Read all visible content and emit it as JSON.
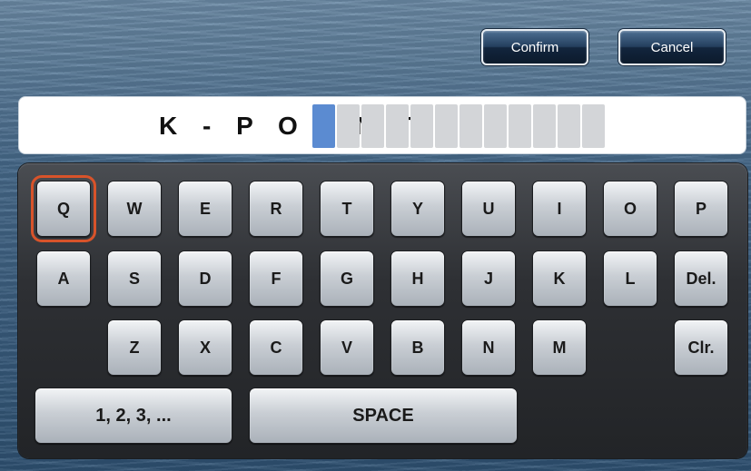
{
  "header": {
    "confirm_label": "Confirm",
    "cancel_label": "Cancel"
  },
  "input": {
    "value": "K-POINT",
    "empty_slots": 12,
    "cursor_color": "#5b8bd1"
  },
  "keyboard": {
    "selected_key": "Q",
    "selection_color": "#d8532a",
    "row1": [
      "Q",
      "W",
      "E",
      "R",
      "T",
      "Y",
      "U",
      "I",
      "O",
      "P"
    ],
    "row2": [
      "A",
      "S",
      "D",
      "F",
      "G",
      "H",
      "J",
      "K",
      "L",
      "Del."
    ],
    "row3": [
      "Z",
      "X",
      "C",
      "V",
      "B",
      "N",
      "M",
      "Clr."
    ],
    "numbers_label": "1, 2, 3, ...",
    "space_label": "SPACE"
  }
}
